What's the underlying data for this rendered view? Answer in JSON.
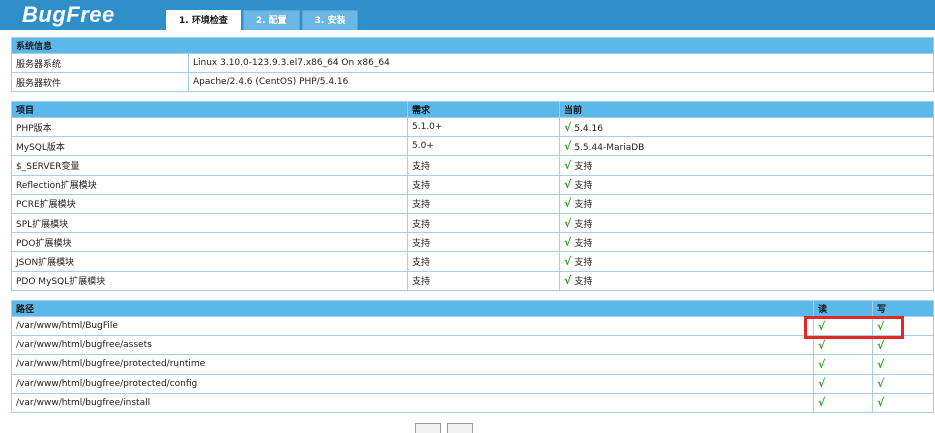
{
  "app": {
    "logo": "BugFree"
  },
  "tabs": [
    {
      "label": "1. 环境检查",
      "active": true
    },
    {
      "label": "2. 配置",
      "active": false
    },
    {
      "label": "3. 安装",
      "active": false
    }
  ],
  "system": {
    "caption": "系统信息",
    "rows": [
      {
        "label": "服务器系统",
        "value": "Linux 3.10.0-123.9.3.el7.x86_64 On x86_64"
      },
      {
        "label": "服务器软件",
        "value": "Apache/2.4.6 (CentOS) PHP/5.4.16"
      }
    ]
  },
  "requirements": {
    "headers": {
      "item": "项目",
      "required": "需求",
      "current": "当前"
    },
    "check_mark": "√",
    "rows": [
      {
        "item": "PHP版本",
        "required": "5.1.0+",
        "current": "5.4.16"
      },
      {
        "item": "MySQL版本",
        "required": "5.0+",
        "current": "5.5.44-MariaDB"
      },
      {
        "item": "$_SERVER变量",
        "required": "支持",
        "current": "支持"
      },
      {
        "item": "Reflection扩展模块",
        "required": "支持",
        "current": "支持"
      },
      {
        "item": "PCRE扩展模块",
        "required": "支持",
        "current": "支持"
      },
      {
        "item": "SPL扩展模块",
        "required": "支持",
        "current": "支持"
      },
      {
        "item": "PDO扩展模块",
        "required": "支持",
        "current": "支持"
      },
      {
        "item": "JSON扩展模块",
        "required": "支持",
        "current": "支持"
      },
      {
        "item": "PDO MySQL扩展模块",
        "required": "支持",
        "current": "支持"
      }
    ]
  },
  "paths": {
    "headers": {
      "path": "路径",
      "read": "读",
      "write": "写"
    },
    "rows": [
      {
        "path": "/var/www/html/BugFile",
        "read": "√",
        "write": "√"
      },
      {
        "path": "/var/www/html/bugfree/assets",
        "read": "√",
        "write": "√"
      },
      {
        "path": "/var/www/html/bugfree/protected/runtime",
        "read": "√",
        "write": "√"
      },
      {
        "path": "/var/www/html/bugfree/protected/config",
        "read": "√",
        "write": "√"
      },
      {
        "path": "/var/www/html/bugfree/install",
        "read": "√",
        "write": "√"
      }
    ]
  },
  "colors": {
    "header_bar": "#2e8fc9",
    "table_header": "#5bb8ea",
    "check": "#2ba01f",
    "annotation": "#e02a2a"
  }
}
